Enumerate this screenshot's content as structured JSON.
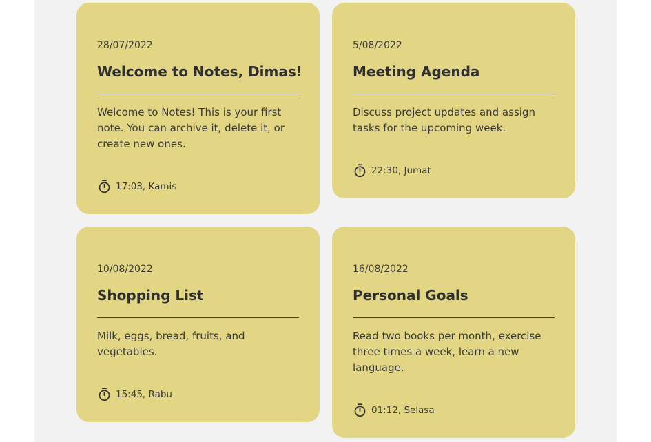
{
  "notes": [
    {
      "date": "28/07/2022",
      "title": "Welcome to Notes, Dimas!",
      "body": "Welcome to Notes! This is your first note. You can archive it, delete it, or create new ones.",
      "time": "17:03, Kamis"
    },
    {
      "date": "5/08/2022",
      "title": "Meeting Agenda",
      "body": "Discuss project updates and assign tasks for the upcoming week.",
      "time": "22:30, Jumat"
    },
    {
      "date": "10/08/2022",
      "title": "Shopping List",
      "body": "Milk, eggs, bread, fruits, and vegetables.",
      "time": "15:45, Rabu"
    },
    {
      "date": "16/08/2022",
      "title": "Personal Goals",
      "body": "Read two books per month, exercise three times a week, learn a new language.",
      "time": "01:12, Selasa"
    }
  ],
  "icons": {
    "time": "timer-icon"
  },
  "colors": {
    "card": "#e2d584",
    "board": "#f2f2f2"
  }
}
